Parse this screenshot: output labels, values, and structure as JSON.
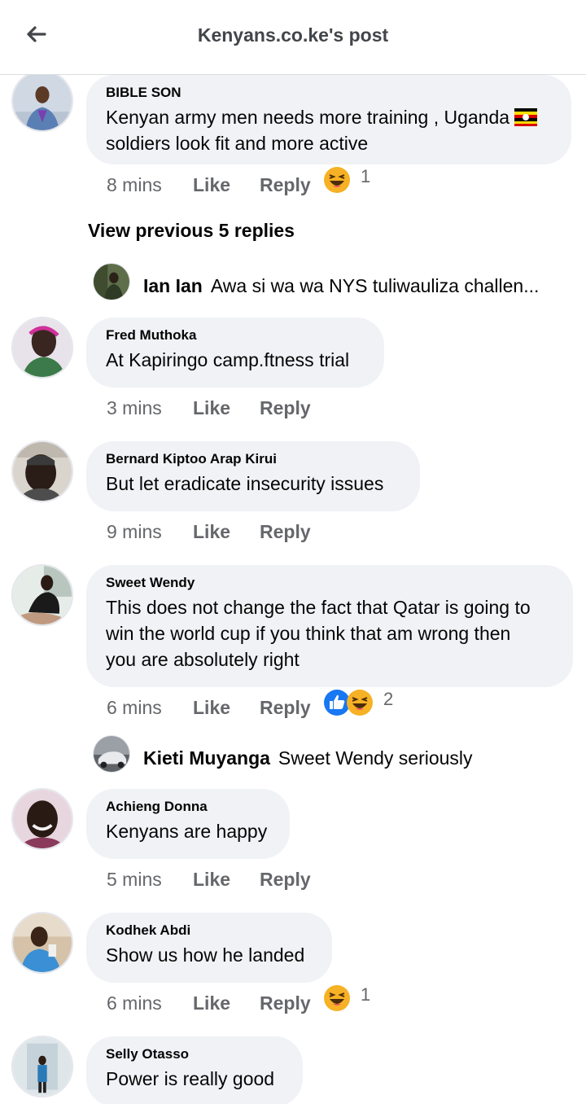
{
  "header": {
    "title": "Kenyans.co.ke's post",
    "back_icon": "arrow-left-icon"
  },
  "actions": {
    "like_label": "Like",
    "reply_label": "Reply"
  },
  "view_previous": "View previous 5 replies",
  "comments": [
    {
      "name": "BIBLE SON",
      "text_line1": "Kenyan army men needs more training , Uganda",
      "flag": "uganda-flag-icon",
      "text_line2": "soldiers look fit and more active",
      "time": "8 mins",
      "reactions": [
        "haha"
      ],
      "reaction_count": "1"
    },
    {
      "name": "Fred Muthoka",
      "text": "At Kapiringo camp.ftness trial",
      "time": "3 mins"
    },
    {
      "name": "Bernard Kiptoo Arap Kirui",
      "text": "But let eradicate insecurity issues",
      "time": "9 mins"
    },
    {
      "name": "Sweet Wendy",
      "text_lines": [
        "This does not change the fact that Qatar is going to",
        "win the world cup if you think that am wrong then",
        "you are absolutely right"
      ],
      "time": "6 mins",
      "reactions": [
        "like",
        "haha"
      ],
      "reaction_count": "2"
    },
    {
      "name": "Achieng Donna",
      "text": "Kenyans are happy",
      "time": "5 mins"
    },
    {
      "name": "Kodhek Abdi",
      "text": "Show us how he landed",
      "time": "6 mins",
      "reactions": [
        "haha"
      ],
      "reaction_count": "1"
    },
    {
      "name": "Selly Otasso",
      "text": "Power is really good"
    }
  ],
  "replies": [
    {
      "name": "Ian Ian",
      "text": "Awa si wa wa NYS tuliwauliza challen..."
    },
    {
      "name": "Kieti Muyanga",
      "text": "Sweet Wendy seriously"
    }
  ],
  "colors": {
    "bubble": "#f0f2f5",
    "meta_text": "#65676b",
    "like_blue": "#1877f2",
    "haha_yellow": "#f7b125"
  }
}
